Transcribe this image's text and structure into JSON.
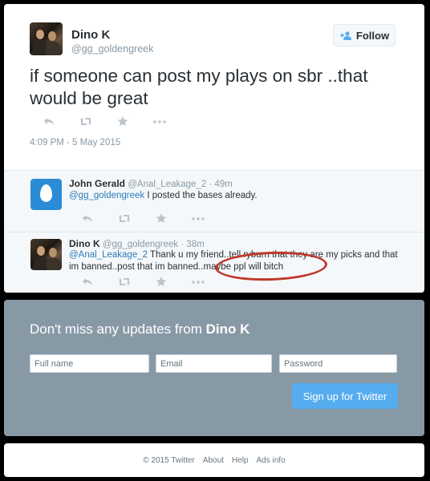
{
  "tweet": {
    "author_name": "Dino K",
    "author_handle": "@gg_goldengreek",
    "follow_label": "Follow",
    "text": "if someone can post my plays on sbr ..that would be great",
    "timestamp": "4:09 PM - 5 May 2015"
  },
  "replies": [
    {
      "name": "John Gerald",
      "handle": "@Anal_Leakage_2",
      "time": "49m",
      "mention": "@gg_goldengreek",
      "text": " I posted the bases already."
    },
    {
      "name": "Dino K",
      "handle": "@gg_goldengreek",
      "time": "38m",
      "mention": "@Anal_Leakage_2",
      "text": " Thank u my friend..tell ryburn that they are my picks and that im banned..post that im banned..maybe ppl will bitch"
    }
  ],
  "signup": {
    "title_prefix": "Don't miss any updates from ",
    "title_name": "Dino K",
    "fullname_placeholder": "Full name",
    "email_placeholder": "Email",
    "password_placeholder": "Password",
    "button_label": "Sign up for Twitter"
  },
  "footer": {
    "copyright": "© 2015 Twitter",
    "about": "About",
    "help": "Help",
    "ads_info": "Ads info"
  },
  "colors": {
    "accent": "#55acee",
    "link": "#2b7bb9",
    "signup_bg": "#8899a6",
    "annotation": "#c0392b"
  }
}
